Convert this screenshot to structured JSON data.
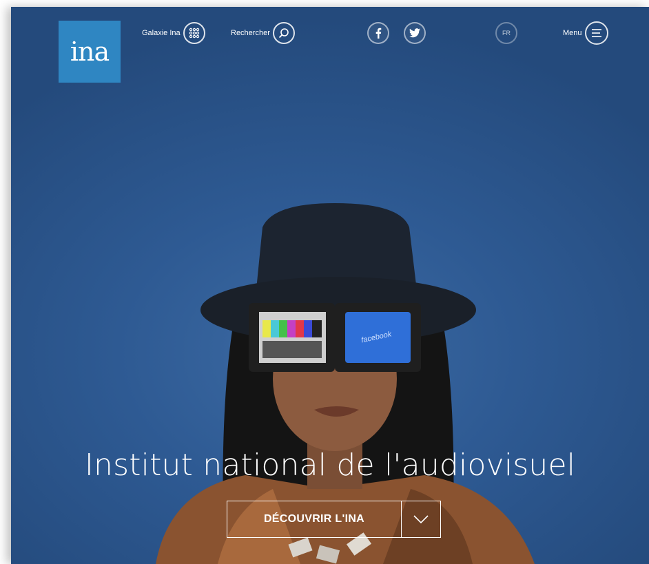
{
  "header": {
    "logo_text": "ina",
    "galaxie_label": "Galaxie Ina",
    "search_label": "Rechercher",
    "lang_label": "FR",
    "menu_label": "Menu",
    "social": [
      "facebook-icon",
      "twitter-icon"
    ]
  },
  "hero": {
    "title": "Institut national de l'audiovisuel",
    "cta_label": "DÉCOUVRIR L'INA",
    "screen_text": "facebook",
    "background_color": "#2e5a93"
  },
  "colors": {
    "logo": "#2f86c2"
  }
}
